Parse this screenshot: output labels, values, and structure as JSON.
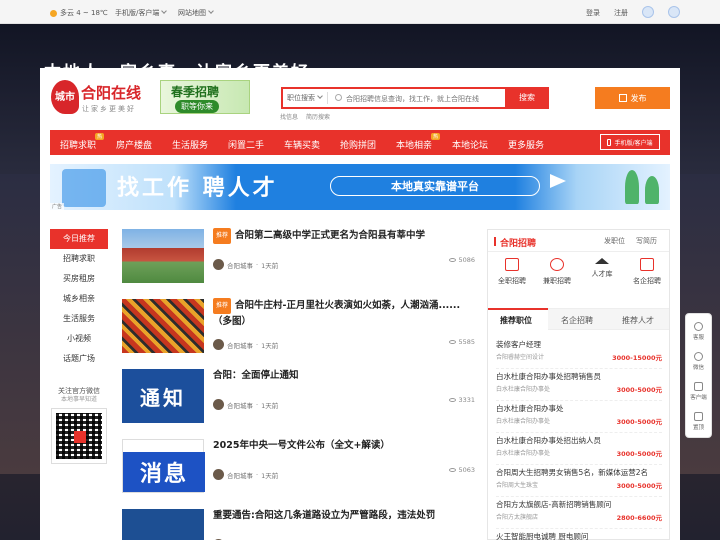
{
  "topbar": {
    "weather": "多云 4 ~ 18℃",
    "mobile": "手机版/客户端",
    "sitemap": "网站地图",
    "login": "登录",
    "register": "注册"
  },
  "banner": {
    "slogan": "本地人，家乡事，让家乡更美好"
  },
  "logo": {
    "badge": "城市",
    "name": "合阳在线",
    "tagline": "让家乡更美好"
  },
  "promo": {
    "title": "春季招聘",
    "subtitle": "职等你来"
  },
  "search": {
    "category": "职位搜索",
    "placeholder": "合阳招聘信息查询，找工作，就上合阳在线",
    "button": "搜索",
    "hot": [
      "找信息",
      "简历搜索"
    ]
  },
  "publish_label": "发布",
  "nav": {
    "items": [
      "招聘求职",
      "房产楼盘",
      "生活服务",
      "闲置二手",
      "车辆买卖",
      "抢购拼团",
      "本地相亲",
      "本地论坛",
      "更多服务"
    ],
    "hot_tag": "热",
    "mobile_label": "手机版/客户端"
  },
  "ad": {
    "headline": "找工作 聘人才",
    "pill": "本地真实靠谱平台",
    "tag": "广告"
  },
  "side": {
    "items": [
      "今日推荐",
      "招聘求职",
      "买房租房",
      "城乡相亲",
      "生活服务",
      "小视频",
      "话题广场"
    ],
    "wechat_title": "关注官方微信",
    "wechat_sub": "本地事早知道"
  },
  "feed": [
    {
      "badge": "推荐",
      "title": "合阳第二高级中学正式更名为合阳县有莘中学",
      "author": "合阳城事",
      "time": "1天前",
      "views": "5086"
    },
    {
      "badge": "推荐",
      "title": "合阳牛庄村-正月里社火表演如火如荼，人潮汹涌......（多图）",
      "author": "合阳城事",
      "time": "1天前",
      "views": "5585"
    },
    {
      "badge": "",
      "title": "合阳：全面停止通知",
      "author": "合阳城事",
      "time": "1天前",
      "views": "3331",
      "thumb": "通知"
    },
    {
      "badge": "",
      "title": "2025年中央一号文件公布（全文+解读）",
      "author": "合阳城事",
      "time": "1天前",
      "views": "5063",
      "thumb": "消息"
    },
    {
      "badge": "",
      "title": "重要通告:合阳这几条道路设立为严管路段，违法处罚",
      "author": "",
      "time": "",
      "views": "",
      "thumb": "通告"
    }
  ],
  "right": {
    "title": "合阳招聘",
    "post_job": "发职位",
    "write_resume": "写简历",
    "icons": [
      "全职招聘",
      "兼职招聘",
      "人才库",
      "名企招聘"
    ],
    "tabs": [
      "推荐职位",
      "名企招聘",
      "推荐人才"
    ],
    "jobs": [
      {
        "title": "装修客户经理",
        "company": "合阳睿赫空间设计",
        "salary": "3000-15000元"
      },
      {
        "title": "白水杜康合阳办事处招聘销售员",
        "company": "白水杜康合阳办事处",
        "salary": "3000-5000元"
      },
      {
        "title": "白水杜康合阳办事处",
        "company": "白水杜康合阳办事处",
        "salary": "3000-5000元"
      },
      {
        "title": "白水杜康合阳办事处招出纳人员",
        "company": "白水杜康合阳办事处",
        "salary": "3000-5000元"
      },
      {
        "title": "合阳周大生招聘男女销售5名，新媒体运营2名",
        "company": "合阳周大生珠宝",
        "salary": "3000-5000元"
      },
      {
        "title": "合阳方太旗舰店-高新招聘销售顾问",
        "company": "合阳方太旗舰店",
        "salary": "2800-6600元"
      },
      {
        "title": "火王智能厨电诚聘 厨电顾问",
        "company": "",
        "salary": ""
      }
    ]
  },
  "floatbar": [
    "客服",
    "微信",
    "客户端",
    "置顶"
  ]
}
